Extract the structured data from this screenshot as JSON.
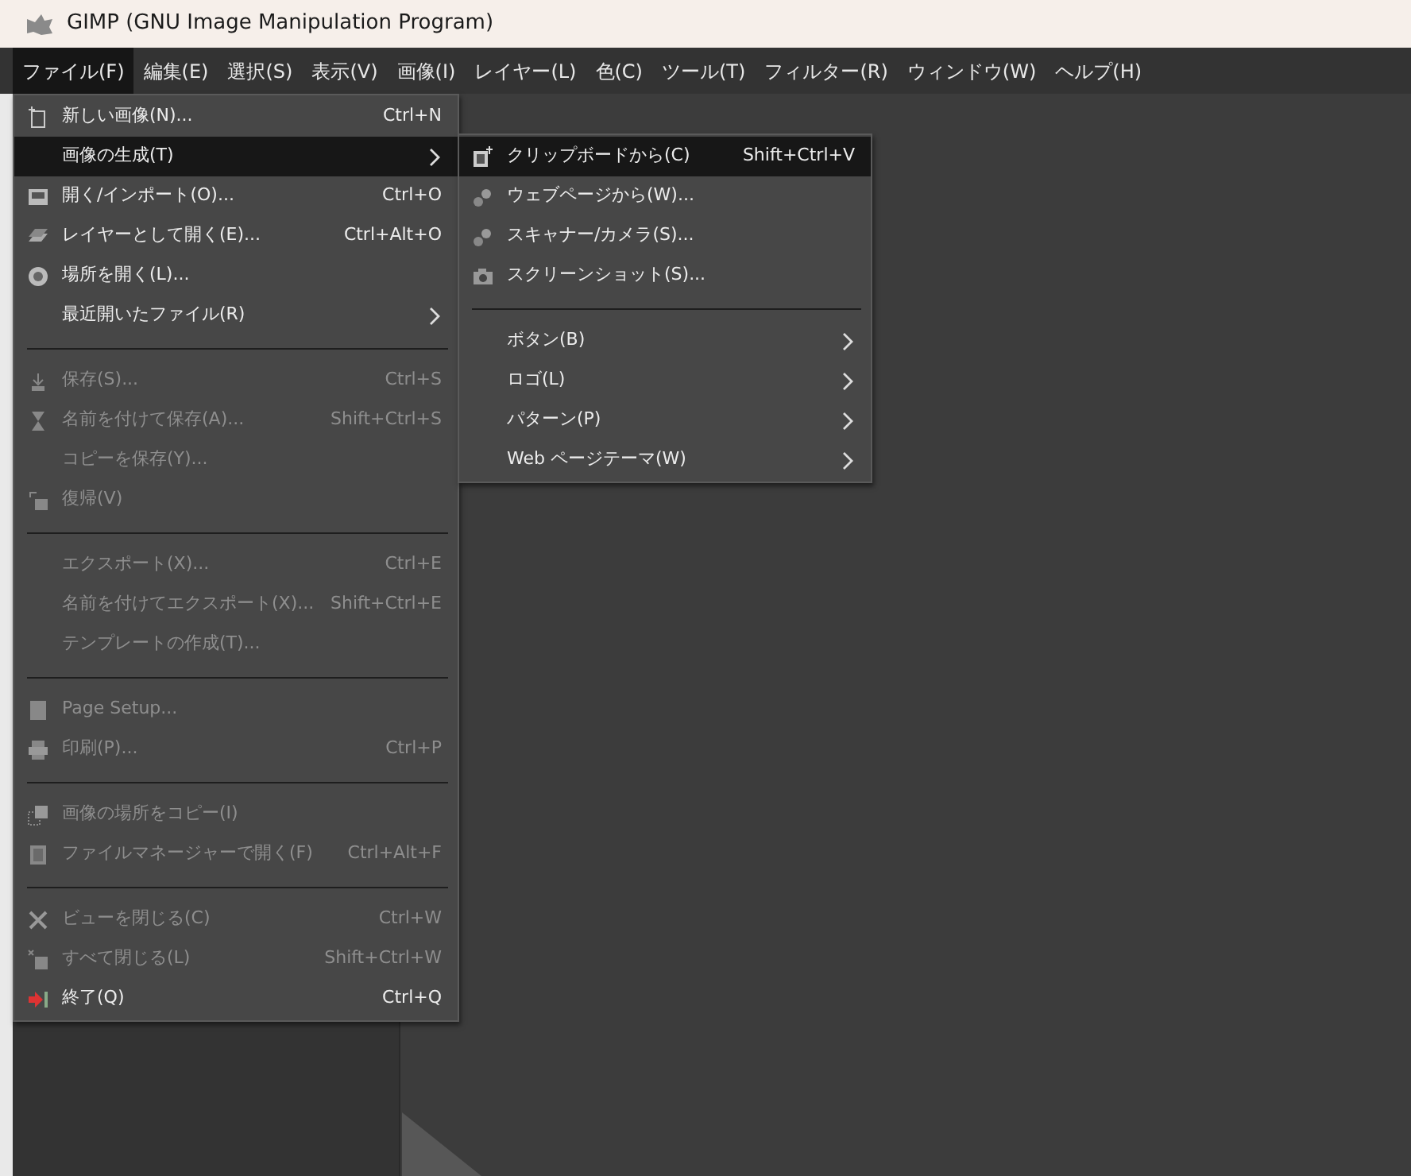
{
  "window": {
    "title": "GIMP (GNU Image Manipulation Program)"
  },
  "menubar": [
    {
      "label": "ファイル(F)",
      "selected": true
    },
    {
      "label": "編集(E)",
      "selected": false
    },
    {
      "label": "選択(S)",
      "selected": false
    },
    {
      "label": "表示(V)",
      "selected": false
    },
    {
      "label": "画像(I)",
      "selected": false
    },
    {
      "label": "レイヤー(L)",
      "selected": false
    },
    {
      "label": "色(C)",
      "selected": false
    },
    {
      "label": "ツール(T)",
      "selected": false
    },
    {
      "label": "フィルター(R)",
      "selected": false
    },
    {
      "label": "ウィンドウ(W)",
      "selected": false
    },
    {
      "label": "ヘルプ(H)",
      "selected": false
    }
  ],
  "file_menu": {
    "sections": [
      [
        {
          "label": "新しい画像(N)...",
          "shortcut": "Ctrl+N",
          "disabled": false,
          "selected": false,
          "submenu": false
        },
        {
          "label": "画像の生成(T)",
          "disabled": false,
          "selected": true,
          "submenu": true
        },
        {
          "label": "開く/インポート(O)...",
          "shortcut": "Ctrl+O",
          "disabled": false,
          "selected": false,
          "submenu": false
        },
        {
          "label": "レイヤーとして開く(E)...",
          "shortcut": "Ctrl+Alt+O",
          "disabled": false,
          "selected": false,
          "submenu": false
        },
        {
          "label": "場所を開く(L)...",
          "disabled": false,
          "selected": false,
          "submenu": false
        },
        {
          "label": "最近開いたファイル(R)",
          "disabled": false,
          "selected": false,
          "submenu": true
        }
      ],
      [
        {
          "label": "保存(S)...",
          "shortcut": "Ctrl+S",
          "disabled": true,
          "selected": false,
          "submenu": false
        },
        {
          "label": "名前を付けて保存(A)...",
          "shortcut": "Shift+Ctrl+S",
          "disabled": true,
          "selected": false,
          "submenu": false
        },
        {
          "label": "コピーを保存(Y)...",
          "disabled": true,
          "selected": false,
          "submenu": false
        },
        {
          "label": "復帰(V)",
          "disabled": true,
          "selected": false,
          "submenu": false
        }
      ],
      [
        {
          "label": "エクスポート(X)...",
          "shortcut": "Ctrl+E",
          "disabled": true,
          "selected": false,
          "submenu": false
        },
        {
          "label": "名前を付けてエクスポート(X)...",
          "shortcut": "Shift+Ctrl+E",
          "disabled": true,
          "selected": false,
          "submenu": false
        },
        {
          "label": "テンプレートの作成(T)...",
          "disabled": true,
          "selected": false,
          "submenu": false
        }
      ],
      [
        {
          "label": "Page Setup...",
          "disabled": true,
          "selected": false,
          "submenu": false
        },
        {
          "label": "印刷(P)...",
          "shortcut": "Ctrl+P",
          "disabled": true,
          "selected": false,
          "submenu": false
        }
      ],
      [
        {
          "label": "画像の場所をコピー(I)",
          "disabled": true,
          "selected": false,
          "submenu": false
        },
        {
          "label": "ファイルマネージャーで開く(F)",
          "shortcut": "Ctrl+Alt+F",
          "disabled": true,
          "selected": false,
          "submenu": false
        }
      ],
      [
        {
          "label": "ビューを閉じる(C)",
          "shortcut": "Ctrl+W",
          "disabled": true,
          "selected": false,
          "submenu": false
        },
        {
          "label": "すべて閉じる(L)",
          "shortcut": "Shift+Ctrl+W",
          "disabled": true,
          "selected": false,
          "submenu": false
        },
        {
          "label": "終了(Q)",
          "shortcut": "Ctrl+Q",
          "disabled": false,
          "selected": false,
          "submenu": false
        }
      ]
    ]
  },
  "submenu": {
    "sections": [
      [
        {
          "label": "クリップボードから(C)",
          "shortcut": "Shift+Ctrl+V",
          "disabled": false,
          "selected": true,
          "submenu": false
        },
        {
          "label": "ウェブページから(W)...",
          "disabled": false,
          "selected": false,
          "submenu": false
        },
        {
          "label": "スキャナー/カメラ(S)...",
          "disabled": false,
          "selected": false,
          "submenu": false
        },
        {
          "label": "スクリーンショット(S)...",
          "disabled": false,
          "selected": false,
          "submenu": false
        }
      ],
      [
        {
          "label": "ボタン(B)",
          "disabled": false,
          "selected": false,
          "submenu": true
        },
        {
          "label": "ロゴ(L)",
          "disabled": false,
          "selected": false,
          "submenu": true
        },
        {
          "label": "パターン(P)",
          "disabled": false,
          "selected": false,
          "submenu": true
        },
        {
          "label": "Web ページテーマ(W)",
          "disabled": false,
          "selected": false,
          "submenu": true
        }
      ]
    ]
  }
}
